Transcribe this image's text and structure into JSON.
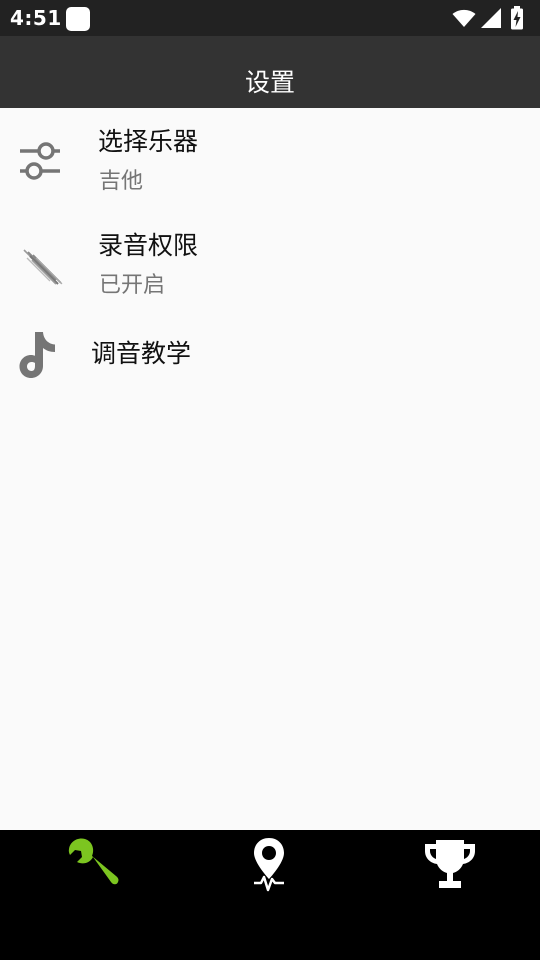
{
  "status_bar": {
    "time": "4:51",
    "icons": [
      "notification-icon",
      "wifi-icon",
      "signal-icon",
      "battery-charging-icon"
    ]
  },
  "app_bar": {
    "title": "设置"
  },
  "settings": [
    {
      "title": "选择乐器",
      "subtitle": "吉他",
      "icon": "sliders-icon"
    },
    {
      "title": "录音权限",
      "subtitle": "已开启",
      "icon": "recording-streaks-icon"
    },
    {
      "title": "调音教学",
      "icon": "music-note-icon"
    }
  ],
  "bottom_nav": {
    "items": [
      {
        "icon": "wrench-icon",
        "active": true
      },
      {
        "icon": "location-pulse-icon",
        "active": false
      },
      {
        "icon": "trophy-icon",
        "active": false
      }
    ],
    "active_color": "#7cc520",
    "inactive_color": "#ffffff"
  },
  "colors": {
    "status_bar": "#222222",
    "app_bar": "#333333",
    "background": "#fafafa",
    "icon_gray": "#757575"
  }
}
